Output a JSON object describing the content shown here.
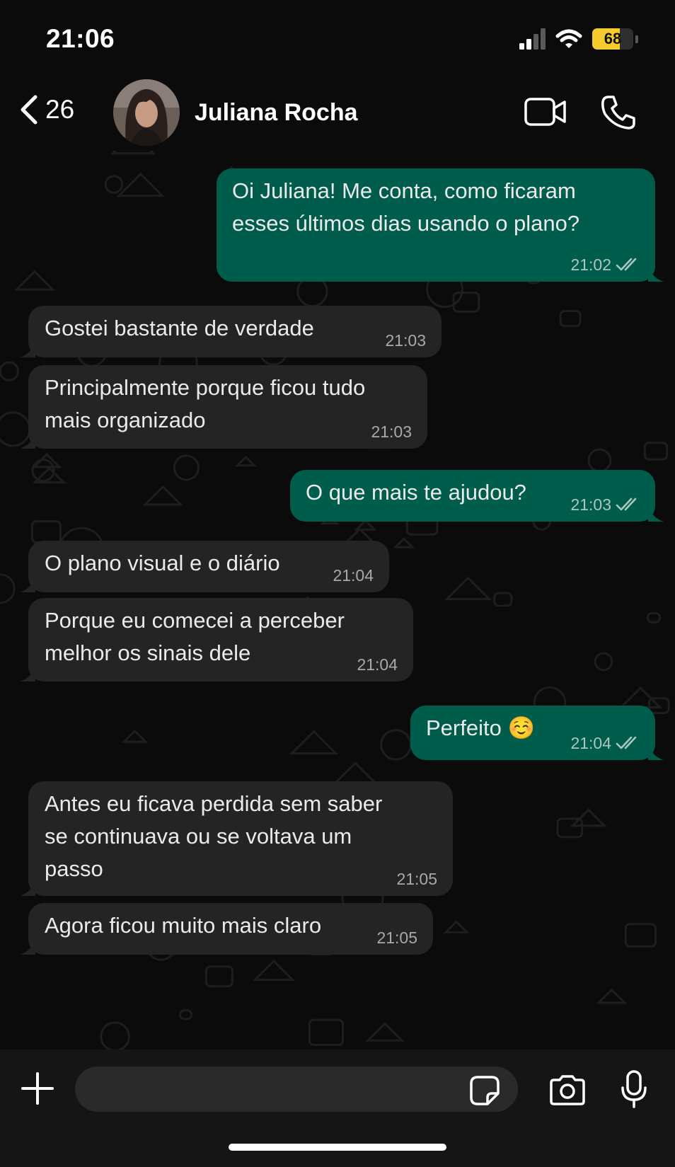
{
  "status_bar": {
    "time": "21:06",
    "battery_level": 68,
    "battery_text": "68",
    "signal_bars_active": 2,
    "wifi": "wifi-icon",
    "battery_color": "#f5cc2c"
  },
  "header": {
    "back_icon": "chevron-left-icon",
    "unread_count": "26",
    "contact_name": "Juliana Rocha",
    "video_call_icon": "video-icon",
    "voice_call_icon": "phone-icon"
  },
  "messages": [
    {
      "direction": "out",
      "lines": [
        "Oi Juliana! Me conta, como ficaram",
        "esses últimos dias usando o plano?"
      ],
      "time": "21:02",
      "status": "read"
    },
    {
      "direction": "in",
      "lines": [
        "Gostei bastante de verdade"
      ],
      "time": "21:03"
    },
    {
      "direction": "in",
      "lines": [
        "Principalmente porque ficou tudo",
        "mais organizado"
      ],
      "time": "21:03"
    },
    {
      "direction": "out",
      "lines": [
        "O que mais te ajudou?"
      ],
      "time": "21:03",
      "status": "read"
    },
    {
      "direction": "in",
      "lines": [
        "O plano visual e o diário"
      ],
      "time": "21:04"
    },
    {
      "direction": "in",
      "lines": [
        "Porque eu comecei a perceber",
        "melhor os sinais dele"
      ],
      "time": "21:04"
    },
    {
      "direction": "out",
      "lines": [
        "Perfeito ☺️"
      ],
      "time": "21:04",
      "status": "read"
    },
    {
      "direction": "in",
      "lines": [
        "Antes eu ficava perdida sem saber",
        "se continuava ou se voltava um",
        "passo"
      ],
      "time": "21:05"
    },
    {
      "direction": "in",
      "lines": [
        "Agora ficou muito mais claro"
      ],
      "time": "21:05"
    }
  ],
  "input_bar": {
    "placeholder": "",
    "attach_icon": "plus-icon",
    "sticker_icon": "sticker-icon",
    "camera_icon": "camera-icon",
    "mic_icon": "microphone-icon"
  },
  "colors": {
    "outgoing_bubble": "#005c4b",
    "incoming_bubble": "#242424",
    "background": "#0b0b0b",
    "read_ticks": "#a8c7bf"
  }
}
